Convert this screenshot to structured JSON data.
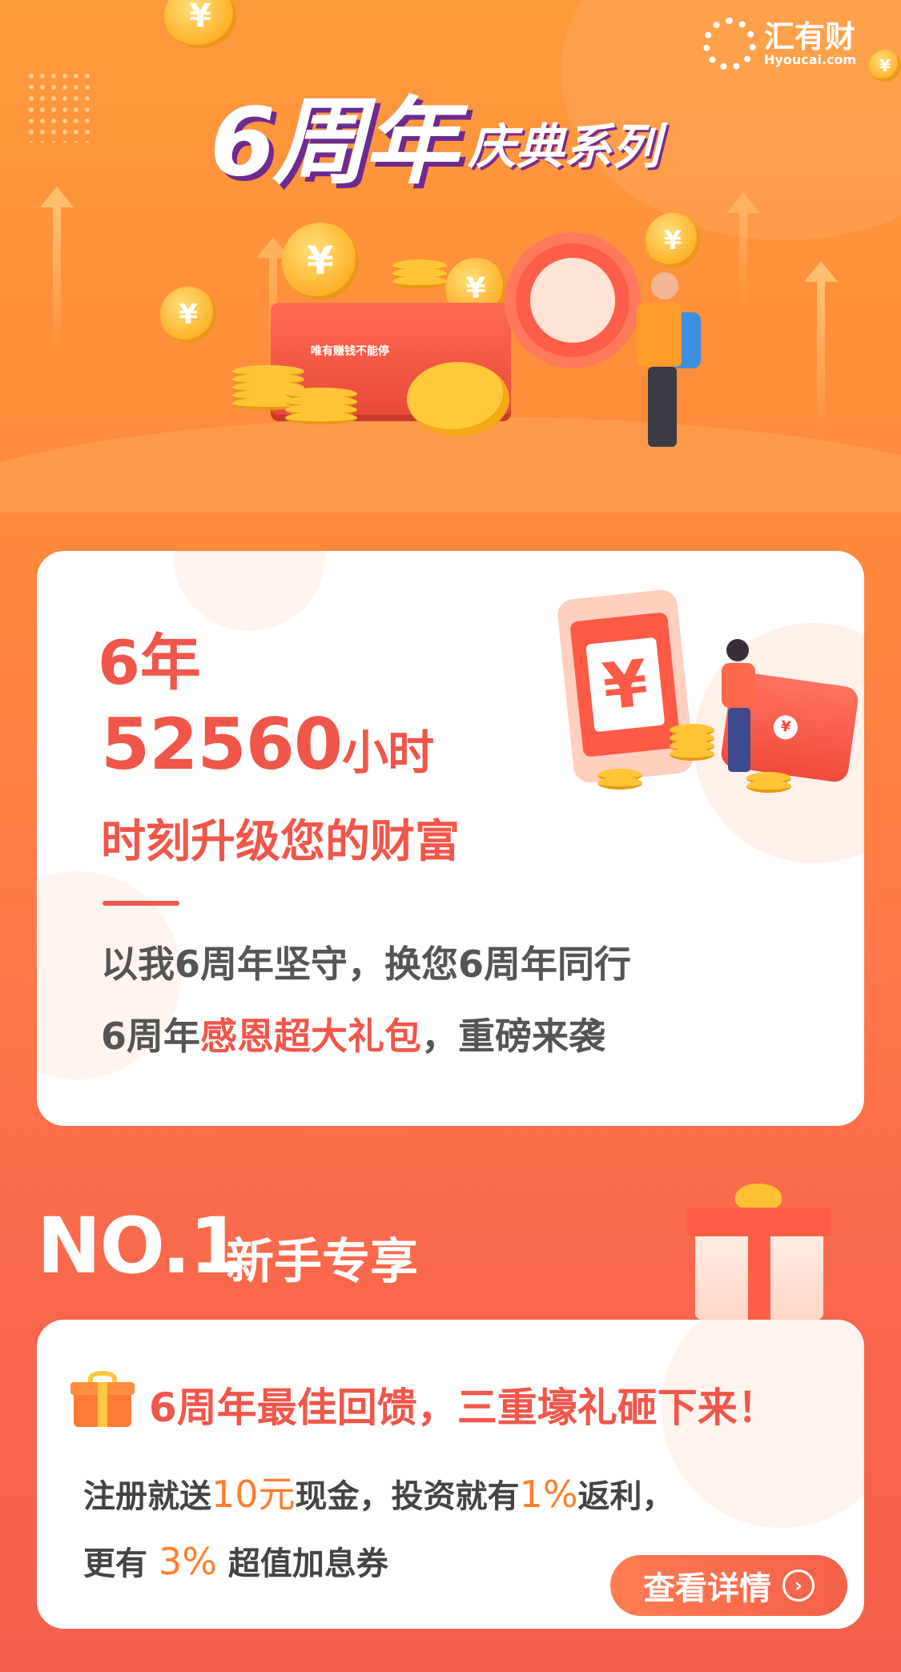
{
  "header": {
    "logo_name": "汇有财",
    "logo_domain": "Hyoucai.com",
    "title_main": "6周年",
    "title_sub": "庆典系列",
    "chest_label": "唯有赚钱不能停"
  },
  "intro_card": {
    "years": "6年",
    "hours_number": "52560",
    "hours_unit": "小时",
    "slogan": "时刻升级您的财富",
    "line1": "以我6周年坚守，换您6周年同行",
    "line2_prefix": "6周年",
    "line2_highlight": "感恩超大礼包",
    "line2_suffix": "，重磅来袭",
    "phone_symbol": "¥",
    "wallet_symbol": "¥"
  },
  "section": {
    "number": "NO.1",
    "title": "新手专享"
  },
  "offer_card": {
    "title": "6周年最佳回馈，三重壕礼砸下来！",
    "line1_a": "注册就送",
    "line1_num1": "10元",
    "line1_b": "现金，投资就有",
    "line1_num2": "1%",
    "line1_c": "返利，",
    "line2_a": "更有 ",
    "line2_num": "3%",
    "line2_b": " 超值加息券",
    "cta_label": "查看详情"
  },
  "colors": {
    "accent_red": "#f0564a",
    "accent_orange": "#ff7e2c",
    "bg_top": "#ff9a3c",
    "bg_bottom": "#f5604e"
  }
}
